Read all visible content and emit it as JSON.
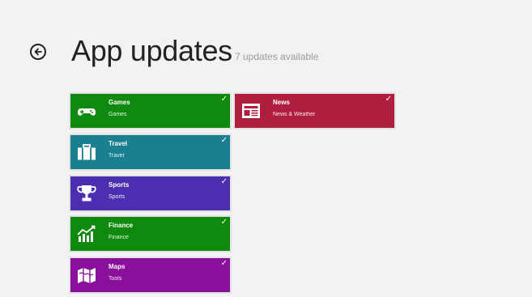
{
  "header": {
    "title": "App updates",
    "subtitle": "7 updates available"
  },
  "tiles": [
    {
      "name": "Games",
      "category": "Games",
      "color": "#0f8a0f",
      "icon": "gamepad-icon"
    },
    {
      "name": "News",
      "category": "News & Weather",
      "color": "#b01e3f",
      "icon": "newspaper-icon"
    },
    {
      "name": "Travel",
      "category": "Travel",
      "color": "#1a7f8f",
      "icon": "suitcase-icon"
    },
    {
      "name": "Sports",
      "category": "Sports",
      "color": "#4b2fb0",
      "icon": "trophy-icon"
    },
    {
      "name": "Finance",
      "category": "Finance",
      "color": "#0f8a0f",
      "icon": "chart-icon"
    },
    {
      "name": "Maps",
      "category": "Tools",
      "color": "#8a0f9a",
      "icon": "map-icon"
    }
  ],
  "selected_mark": "✓"
}
